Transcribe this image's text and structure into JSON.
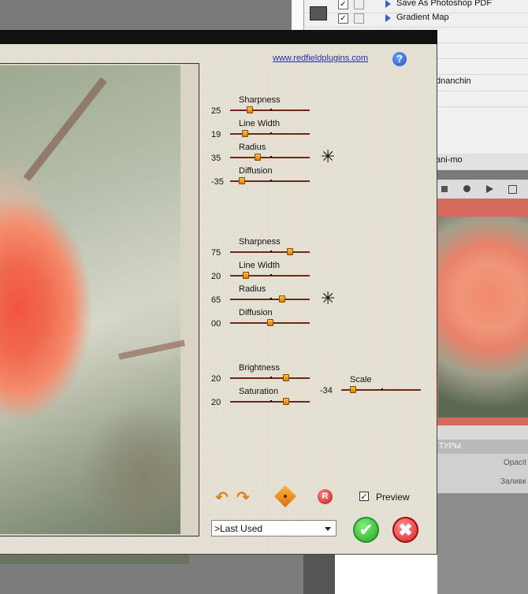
{
  "background_app": {
    "actions": [
      {
        "label": "Save As Photoshop PDF",
        "checked": true
      },
      {
        "label": "Gradient Map",
        "checked": true
      },
      {
        "label": "",
        "checked": false
      },
      {
        "label": "",
        "checked": false
      },
      {
        "label": "",
        "checked": false
      },
      {
        "label": "dnanchin",
        "checked": false
      },
      {
        "label": "",
        "checked": false
      },
      {
        "label": "ani-mo",
        "checked": false
      }
    ],
    "layers_tab": "ТУРЫ",
    "opacity_label": "Opacit",
    "fill_label": "Заливк"
  },
  "dialog": {
    "website": "www.redfieldplugins.com",
    "help_symbol": "?",
    "group1": [
      {
        "label": "Sharpness",
        "value": "25",
        "level": 0.25
      },
      {
        "label": "Line Width",
        "value": "19",
        "level": 0.19
      },
      {
        "label": "Radius",
        "value": "35",
        "level": 0.35
      },
      {
        "label": "Diffusion",
        "value": "-35",
        "level": 0.15
      }
    ],
    "group2": [
      {
        "label": "Sharpness",
        "value": "75",
        "level": 0.75
      },
      {
        "label": "Line Width",
        "value": "20",
        "level": 0.2
      },
      {
        "label": "Radius",
        "value": "65",
        "level": 0.65
      },
      {
        "label": "Diffusion",
        "value": "00",
        "level": 0.5
      }
    ],
    "group3": [
      {
        "label": "Brightness",
        "value": "20",
        "level": 0.7
      },
      {
        "label": "Saturation",
        "value": "20",
        "level": 0.7
      }
    ],
    "scale": {
      "label": "Scale",
      "value": "-34",
      "level": 0.15
    },
    "star_symbol": "✳",
    "undo_symbol": "↶",
    "redo_symbol": "↷",
    "reset_symbol": "R",
    "preview": {
      "label": "Preview",
      "checked": true,
      "check_symbol": "✓"
    },
    "preset": ">Last Used",
    "ok_symbol": "✔",
    "cancel_symbol": "✖"
  }
}
